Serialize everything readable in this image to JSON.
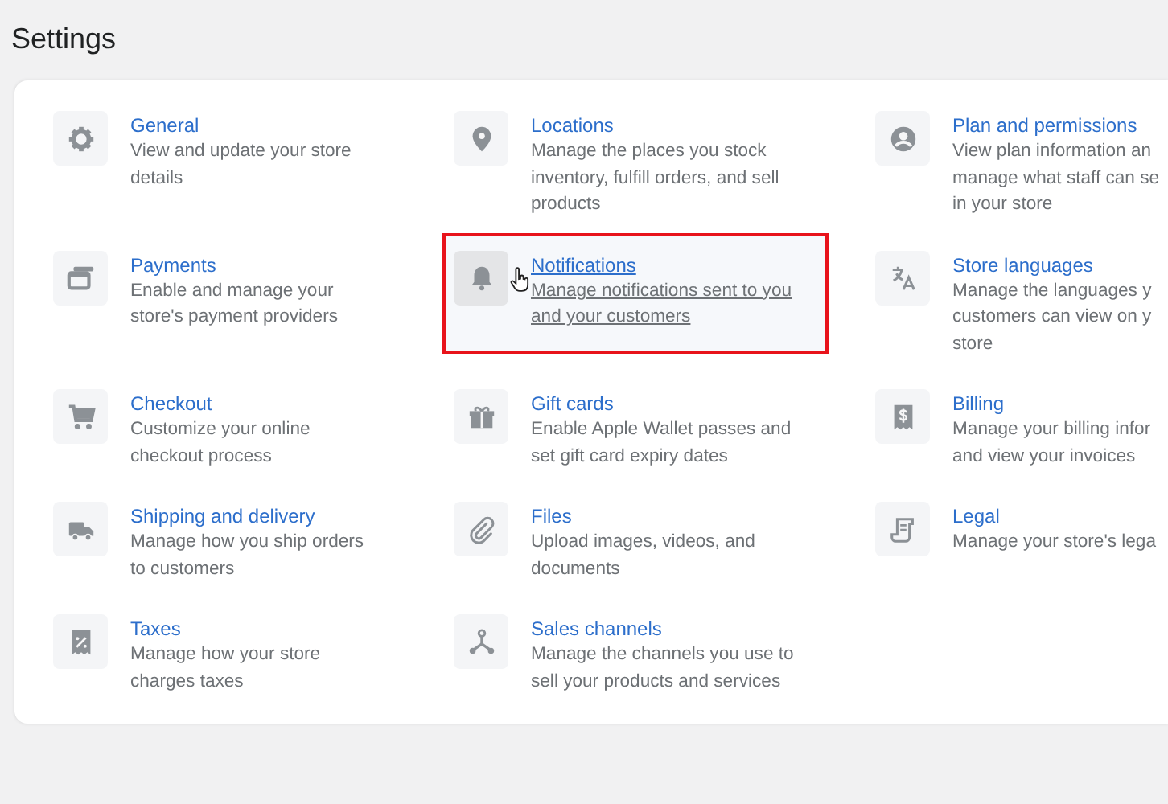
{
  "page": {
    "title": "Settings"
  },
  "items": [
    {
      "title": "General",
      "lines": [
        "View and update your store",
        "details"
      ],
      "hovered": false,
      "highlighted": false
    },
    {
      "title": "Locations",
      "lines": [
        "Manage the places you stock",
        "inventory, fulfill orders, and sell",
        "products"
      ],
      "hovered": false,
      "highlighted": false
    },
    {
      "title": "Plan and permissions",
      "lines": [
        "View plan information an",
        "manage what staff can se",
        "in your store"
      ],
      "hovered": false,
      "highlighted": false
    },
    {
      "title": "Payments",
      "lines": [
        "Enable and manage your",
        "store's payment providers"
      ],
      "hovered": false,
      "highlighted": false
    },
    {
      "title": "Notifications",
      "lines": [
        "Manage notifications sent to you",
        "and your customers"
      ],
      "hovered": true,
      "highlighted": true
    },
    {
      "title": "Store languages",
      "lines": [
        "Manage the languages y",
        "customers can view on y",
        "store"
      ],
      "hovered": false,
      "highlighted": false
    },
    {
      "title": "Checkout",
      "lines": [
        "Customize your online",
        "checkout process"
      ],
      "hovered": false,
      "highlighted": false
    },
    {
      "title": "Gift cards",
      "lines": [
        "Enable Apple Wallet passes and",
        "set gift card expiry dates"
      ],
      "hovered": false,
      "highlighted": false
    },
    {
      "title": "Billing",
      "lines": [
        "Manage your billing infor",
        "and view your invoices"
      ],
      "hovered": false,
      "highlighted": false
    },
    {
      "title": "Shipping and delivery",
      "lines": [
        "Manage how you ship orders",
        "to customers"
      ],
      "hovered": false,
      "highlighted": false
    },
    {
      "title": "Files",
      "lines": [
        "Upload images, videos, and",
        "documents"
      ],
      "hovered": false,
      "highlighted": false
    },
    {
      "title": "Legal",
      "lines": [
        "Manage your store's lega"
      ],
      "hovered": false,
      "highlighted": false
    },
    {
      "title": "Taxes",
      "lines": [
        "Manage how your store",
        "charges taxes"
      ],
      "hovered": false,
      "highlighted": false
    },
    {
      "title": "Sales channels",
      "lines": [
        "Manage the channels you use to",
        "sell your products and services"
      ],
      "hovered": false,
      "highlighted": false
    }
  ]
}
